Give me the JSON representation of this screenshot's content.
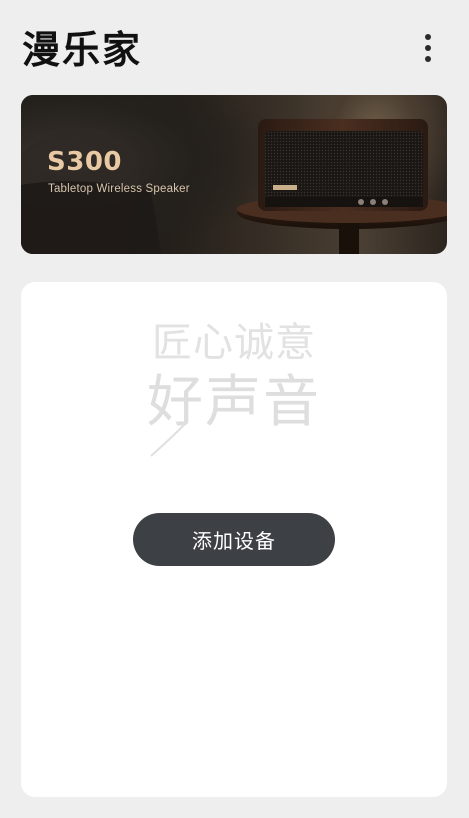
{
  "header": {
    "app_title": "漫乐家"
  },
  "banner": {
    "model": "S300",
    "subtitle": "Tabletop Wireless Speaker"
  },
  "main": {
    "slogan_line1": "匠心诚意",
    "slogan_line2": "好声音",
    "add_device_label": "添加设备"
  },
  "colors": {
    "background": "#eeeeee",
    "card": "#ffffff",
    "button": "#3d4045",
    "banner_title": "#e8c9a3"
  },
  "icons": {
    "more_menu": "more-vertical-icon"
  }
}
